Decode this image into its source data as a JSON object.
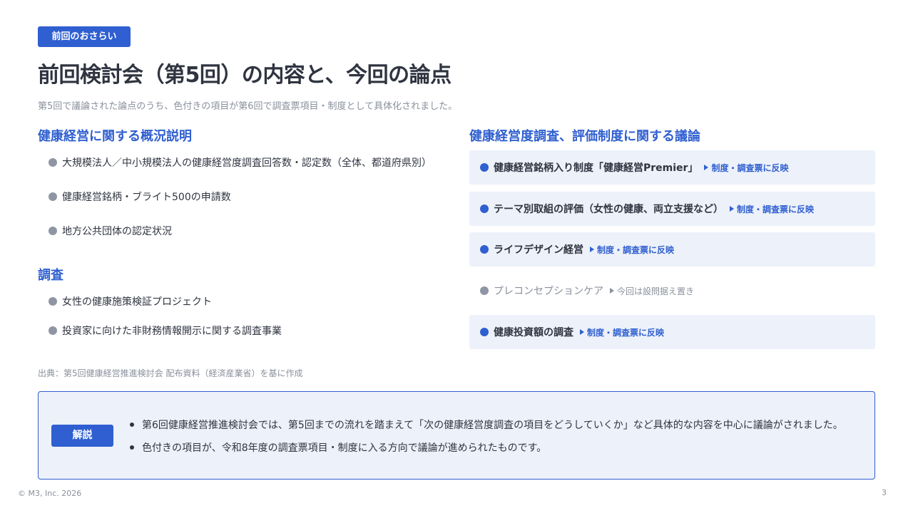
{
  "header": {
    "tag": "前回のおさらい",
    "title": "前回検討会（第5回）の内容と、今回の論点",
    "subtitle": "第5回で議論された論点のうち、色付きの項目が第6回で調査票項目・制度として具体化されました。"
  },
  "left": {
    "section1": {
      "heading": "健康経営に関する概況説明",
      "items": [
        "大規模法人／中小規模法人の健康経営度調査回答数・認定数（全体、都道府県別）",
        "健康経営銘柄・ブライト500の申請数",
        "地方公共団体の認定状況"
      ]
    },
    "section2": {
      "heading": "調査",
      "items": [
        "女性の健康施策検証プロジェクト",
        "投資家に向けた非財務情報開示に関する調査事業"
      ]
    }
  },
  "right": {
    "heading": "健康経営度調査、評価制度に関する議論",
    "items": [
      {
        "label": "健康経営銘柄入り制度「健康経営Premier」",
        "note": "制度・調査票に反映",
        "highlighted": true
      },
      {
        "label": "テーマ別取組の評価（女性の健康、両立支援など）",
        "note": "制度・調査票に反映",
        "highlighted": true
      },
      {
        "label": "ライフデザイン経営",
        "note": "制度・調査票に反映",
        "highlighted": true
      },
      {
        "label": "プレコンセプションケア",
        "note": "今回は設問据え置き",
        "highlighted": false
      },
      {
        "label": "健康投資額の調査",
        "note": "制度・調査票に反映",
        "highlighted": true
      }
    ]
  },
  "source": "出典：第5回健康経営推進検討会 配布資料（経済産業省）を基に作成",
  "explanation": {
    "badge": "解説",
    "bullets": [
      "第6回健康経営推進検討会では、第5回までの流れを踏まえて「次の健康経営度調査の項目をどうしていくか」など具体的な内容を中心に議論がされました。",
      "色付きの項目が、令和8年度の調査票項目・制度に入る方向で議論が進められたものです。"
    ]
  },
  "footer": {
    "copyright": "© M3, Inc. 2026",
    "page": "3"
  },
  "colors": {
    "accent": "#2f5fd0",
    "highlight_bg": "#edf1f9",
    "muted": "#8a909c",
    "text": "#2f3440"
  }
}
